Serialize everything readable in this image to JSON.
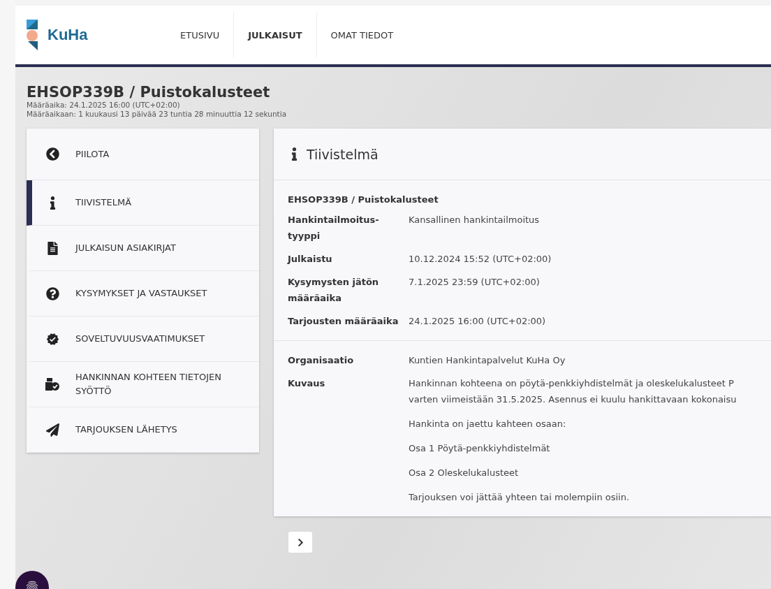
{
  "header": {
    "logo": "KuHa",
    "nav": [
      {
        "label": "ETUSIVU",
        "selected": false
      },
      {
        "label": "JULKAISUT",
        "selected": true
      },
      {
        "label": "OMAT TIEDOT",
        "selected": false
      }
    ]
  },
  "page": {
    "title": "EHSOP339B / Puistokalusteet",
    "deadline": "Määräaika: 24.1.2025 16:00 (UTC+02:00)",
    "countdown": "Määräaikaan: 1 kuukausi 13 päivää 23 tuntia 28 minuuttia 12 sekuntia"
  },
  "sidebar": {
    "items": [
      {
        "kind": "hide",
        "label": "PIILOTA",
        "selected": false
      },
      {
        "kind": "info",
        "label": "TIIVISTELMÄ",
        "selected": true
      },
      {
        "kind": "document",
        "label": "JULKAISUN ASIAKIRJAT",
        "selected": false
      },
      {
        "kind": "question",
        "label": "KYSYMYKSET JA VASTAUKSET",
        "selected": false
      },
      {
        "kind": "badge",
        "label": "SOVELTUVUUSVAATIMUKSET",
        "selected": false
      },
      {
        "kind": "boxes",
        "label": "HANKINNAN KOHTEEN TIETOJEN SYÖTTÖ",
        "selected": false
      },
      {
        "kind": "send",
        "label": "TARJOUKSEN LÄHETYS",
        "selected": false
      }
    ]
  },
  "summary": {
    "title": "Tiivistelmä",
    "subtitle": "EHSOP339B / Puistokalusteet",
    "fields": [
      {
        "label": "Hankintailmoitus-tyyppi",
        "value": "Kansallinen hankintailmoitus"
      },
      {
        "label": "Julkaistu",
        "value": "10.12.2024 15:52 (UTC+02:00)"
      },
      {
        "label": "Kysymysten jätön määräaika",
        "value": "7.1.2025 23:59 (UTC+02:00)"
      },
      {
        "label": "Tarjousten määräaika",
        "value": "24.1.2025 16:00 (UTC+02:00)"
      }
    ],
    "organisation": {
      "label": "Organisaatio",
      "value": "Kuntien Hankintapalvelut KuHa Oy"
    },
    "description": {
      "label": "Kuvaus",
      "lines": [
        "Hankinnan kohteena on pöytä-penkkiyhdistelmät ja oleskelukalusteet P",
        "varten viimeistään 31.5.2025. Asennus ei kuulu hankittavaan kokonaisu"
      ],
      "paragraphs": [
        "Hankinta on jaettu kahteen osaan:",
        "Osa 1 Pöytä-penkkiyhdistelmät",
        "Osa 2 Oleskelukalusteet",
        "Tarjouksen voi jättää yhteen tai molempiin osiin."
      ]
    }
  }
}
